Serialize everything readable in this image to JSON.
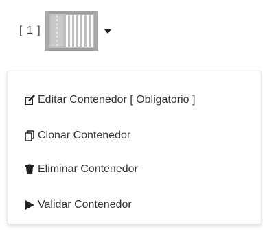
{
  "trigger": {
    "index_label": "[ 1 ]",
    "icon": "shipping-container-icon",
    "caret_icon": "caret-down-icon"
  },
  "menu": {
    "items": [
      {
        "label": "Editar Contenedor [ Obligatorio ]",
        "icon": "edit-icon"
      },
      {
        "label": "Clonar Contenedor",
        "icon": "clone-icon"
      },
      {
        "label": "Eliminar Contenedor",
        "icon": "trash-icon"
      },
      {
        "label": "Validar Contenedor",
        "icon": "play-icon"
      }
    ]
  },
  "colors": {
    "container_body": "#bfbfbf",
    "container_frame": "#9a9a9a",
    "menu_text": "#333333",
    "menu_border": "#e6e6e6"
  }
}
